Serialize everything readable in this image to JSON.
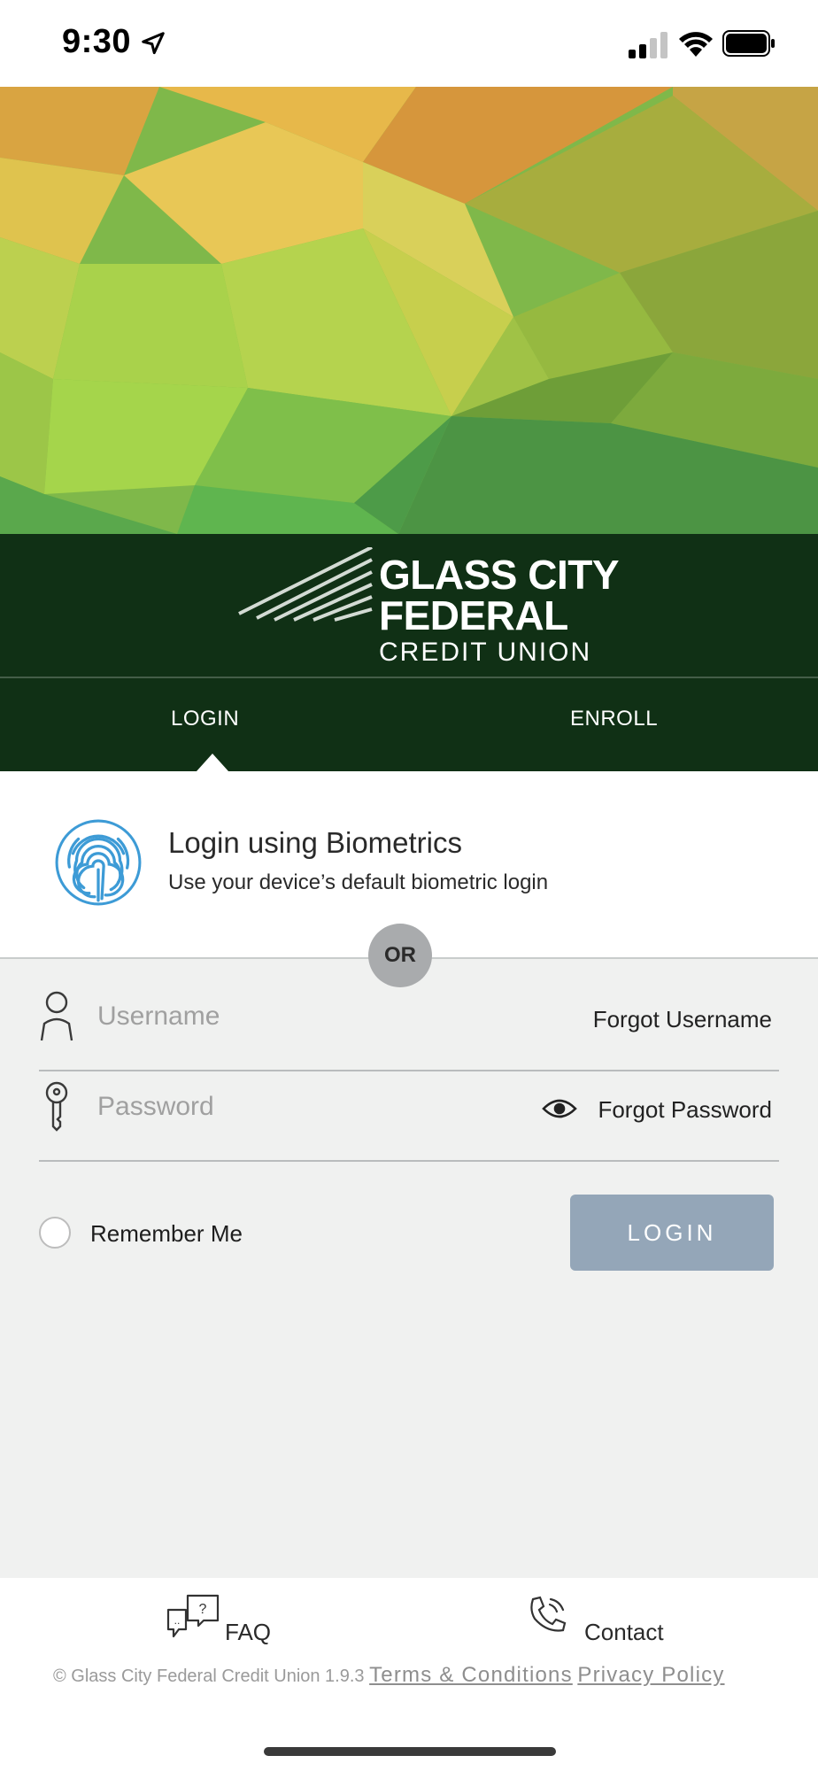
{
  "status_bar": {
    "time": "9:30"
  },
  "brand": {
    "line1": "GLASS CITY",
    "line2": "FEDERAL",
    "line3": "CREDIT UNION"
  },
  "tabs": [
    {
      "label": "LOGIN"
    },
    {
      "label": "ENROLL"
    }
  ],
  "biometrics": {
    "title": "Login using Biometrics",
    "subtitle": "Use your device’s default biometric login"
  },
  "divider": {
    "label": "OR"
  },
  "form": {
    "username": {
      "placeholder": "Username",
      "value": "",
      "forgot_label": "Forgot Username"
    },
    "password": {
      "placeholder": "Password",
      "value": "",
      "forgot_label": "Forgot Password"
    },
    "remember_me": {
      "label": "Remember Me",
      "checked": false
    },
    "login_button": "LOGIN"
  },
  "footer": {
    "faq_label": "FAQ",
    "contact_label": "Contact",
    "copyright": "© Glass City Federal Credit Union 1.9.3",
    "terms_label": "Terms & Conditions",
    "privacy_label": "Privacy Policy"
  },
  "colors": {
    "login_button_bg": "#94a6b8",
    "fingerprint": "#3d9bd6",
    "brand_bar": "#0a230f"
  }
}
